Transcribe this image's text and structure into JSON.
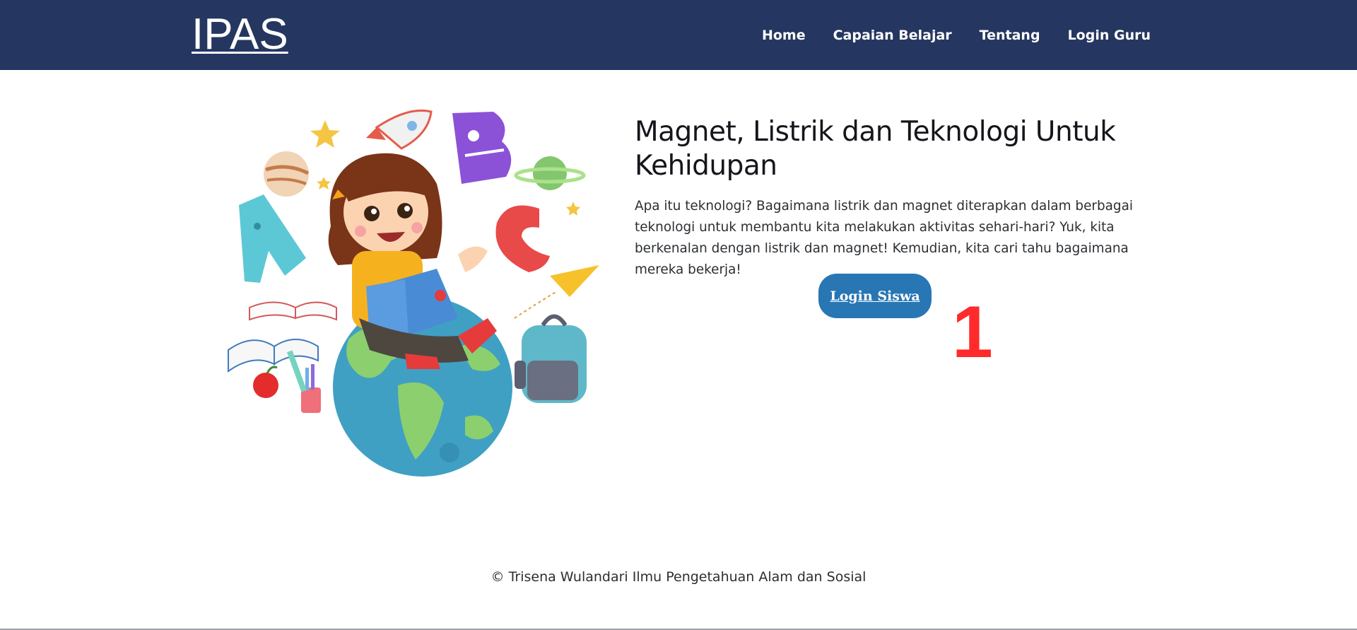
{
  "header": {
    "brand": "IPAS",
    "nav": [
      "Home",
      "Capaian Belajar",
      "Tentang",
      "Login Guru"
    ]
  },
  "hero": {
    "title": "Magnet, Listrik dan Teknologi Untuk Kehidupan",
    "description": "Apa itu teknologi? Bagaimana listrik dan magnet diterapkan dalam berbagai teknologi untuk membantu kita melakukan aktivitas sehari-hari? Yuk, kita berkenalan dengan listrik dan magnet! Kemudian, kita cari tahu bagaimana mereka bekerja!",
    "login_button": "Login Siswa",
    "annotation": "1"
  },
  "footer": {
    "text": "© Trisena Wulandari Ilmu Pengetahuan Alam dan Sosial"
  },
  "colors": {
    "navbar": "#253660",
    "button": "#2876b4",
    "annotation": "#ff2a2a"
  }
}
